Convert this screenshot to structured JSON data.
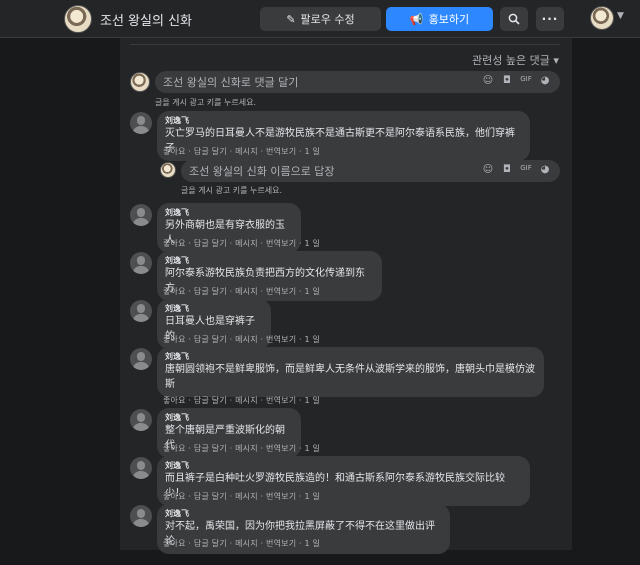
{
  "page": {
    "title": "조선 왕실의 신화"
  },
  "header": {
    "follow_label": "팔로우 수정",
    "promote_label": "홍보하기",
    "more_label": "···"
  },
  "sort": {
    "label": "관련성 높은 댓글 ▾"
  },
  "composer": {
    "placeholder": "조선 왕실의 신화로 댓글 달기",
    "hint": "글을 게시 광고 키를 누르세요."
  },
  "reply_composer": {
    "placeholder": "조선 왕실의 신화 이름으로 답장",
    "hint": "글을 게시 광고 키를 누르세요."
  },
  "action_text": "좋아요 · 답글 달기 · 메시지 · 번역보기 · 1 일",
  "comments": [
    {
      "author": "刘逸飞",
      "text": "灭亡罗马的日耳曼人不是游牧民族不是通古斯更不是阿尔泰语系民族，他们穿裤子"
    },
    {
      "author": "刘逸飞",
      "text": "另外商朝也是有穿衣服的玉人"
    },
    {
      "author": "刘逸飞",
      "text": "阿尔泰系游牧民族负责把西方的文化传递到东方"
    },
    {
      "author": "刘逸飞",
      "text": "日耳曼人也是穿裤子的"
    },
    {
      "author": "刘逸飞",
      "text_line1": "唐朝圆领袍不是鲜卑服饰，而是鲜卑人无条件从波斯学来的服饰，唐朝头巾是模仿波",
      "text_line2": "斯"
    },
    {
      "author": "刘逸飞",
      "text": "整个唐朝是严重波斯化的朝代"
    },
    {
      "author": "刘逸飞",
      "text": "而且裤子是白种吐火罗游牧民族造的！和通古斯系阿尔泰系游牧民族交际比较少！"
    },
    {
      "author": "刘逸飞",
      "text": "对不起，禹荣国，因为你把我拉黑屏蔽了不得不在这里做出评论"
    }
  ]
}
